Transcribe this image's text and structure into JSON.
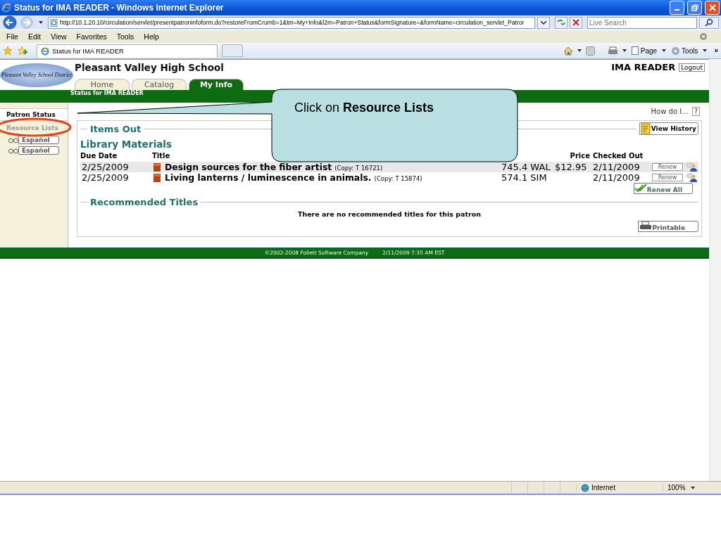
{
  "window": {
    "title": "Status for IMA READER - Windows Internet Explorer"
  },
  "address_bar": {
    "url": "http://10.1.20.10/circulation/servlet/presentpatroninfoform.do?restoreFromCrumb=1&tm=My+Info&l2m=Patron+Status&formSignature=&formName=circulation_servlet_Patror"
  },
  "search": {
    "placeholder": "Live Search"
  },
  "menu": [
    "File",
    "Edit",
    "View",
    "Favorites",
    "Tools",
    "Help"
  ],
  "browser_tab": {
    "title": "Status for IMA READER"
  },
  "command_bar": {
    "buttons": [
      "Page",
      "Tools"
    ],
    "overflow": "»"
  },
  "page": {
    "logo_text": "Pleasant Valley School District",
    "school_name": "Pleasant Valley High School",
    "user_name": "IMA READER",
    "logout": "Logout",
    "tabs": [
      {
        "label": "Home",
        "selected": false
      },
      {
        "label": "Catalog",
        "selected": false
      },
      {
        "label": "My Info",
        "selected": true
      }
    ],
    "breadcrumb": "Status for IMA READER",
    "sidebar": [
      {
        "label": "Patron Status",
        "selected": true
      },
      {
        "label": "Resource Lists",
        "selected": false
      }
    ],
    "language_buttons": [
      "Español",
      "Español"
    ],
    "help_link": "How do I...",
    "help_button": "?",
    "items_out": {
      "title": "Items Out",
      "view_history": "View History",
      "section": "Library Materials",
      "columns": [
        "Due Date",
        "Title",
        "Price",
        "Checked Out"
      ],
      "rows": [
        {
          "due": "2/25/2009",
          "title": "Design sources for the fiber artist",
          "copy": "(Copy: T 16721)",
          "call_number": "745.4 WAL",
          "price": "$12.95",
          "checked_out": "2/11/2009",
          "action": "Renew",
          "highlighted": true
        },
        {
          "due": "2/25/2009",
          "title": "Living lanterns / luminescence in animals.",
          "copy": "(Copy: T 15874)",
          "call_number": "574.1 SIM",
          "price": "",
          "checked_out": "2/11/2009",
          "action": "Renew",
          "highlighted": false
        }
      ],
      "renew_all": "Renew All"
    },
    "recommended": {
      "title": "Recommended Titles",
      "message": "There are no recommended titles for this patron",
      "printable": "Printable"
    },
    "footer": {
      "copyright": "©2002-2008  Follett Software Company",
      "timestamp": "2/11/2009 7:35 AM EST"
    }
  },
  "status_bar": {
    "zone": "Internet",
    "zoom": "100%"
  },
  "callout": {
    "text": "Click on **Resource Lists**"
  }
}
